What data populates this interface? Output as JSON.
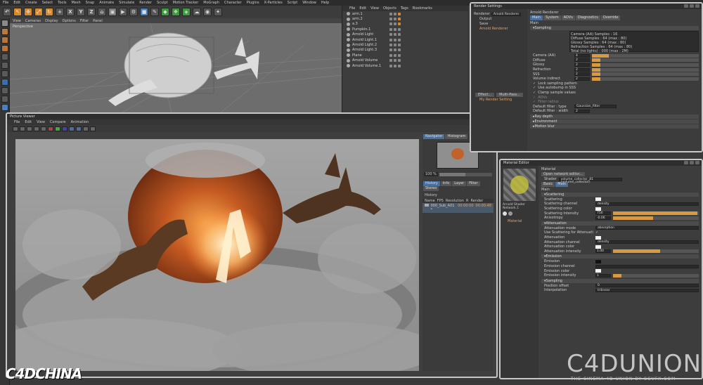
{
  "menubar": [
    "File",
    "Edit",
    "Create",
    "Select",
    "Tools",
    "Mesh",
    "Snap",
    "Animate",
    "Simulate",
    "Render",
    "Sculpt",
    "Motion Tracker",
    "MoGraph",
    "Character",
    "Plugins",
    "X-Particles",
    "Script",
    "Window",
    "Help"
  ],
  "toolbar_letters": [
    "X",
    "Y",
    "Z"
  ],
  "viewport": {
    "menu": [
      "View",
      "Cameras",
      "Display",
      "Options",
      "Filter",
      "Panel"
    ],
    "label": "Perspective"
  },
  "object_manager": {
    "menu": [
      "File",
      "Edit",
      "View",
      "Objects",
      "Tags",
      "Bookmarks"
    ],
    "objects": [
      "arm.1",
      "arm.2",
      "a.3",
      "Pumpkin.1",
      "Arnold Light",
      "Arnold Light.1",
      "Arnold Light.2",
      "Arnold Light.3",
      "Plane",
      "Arnold Volume",
      "Arnold Volume.1"
    ]
  },
  "picture_viewer": {
    "title": "Picture Viewer",
    "menu": [
      "File",
      "Edit",
      "View",
      "Compare",
      "Animation"
    ],
    "nav_tabs": [
      "Navigator",
      "Histogram"
    ],
    "zoom": "100 %",
    "info_tabs": [
      "History",
      "Info",
      "Layer",
      "Filter",
      "Stereo"
    ],
    "history_label": "History",
    "history_headers": [
      "Name",
      "FPS",
      "Resolution",
      "R",
      "Render"
    ],
    "history_row": {
      "name": "000_Sub_A01 *",
      "time": "00:00:00",
      "render": "00:00:48"
    }
  },
  "render_settings": {
    "title": "Render Settings",
    "renderer_label": "Renderer",
    "renderer_value": "Arnold Renderer",
    "left_items": [
      "Output",
      "Save",
      "Arnold Renderer"
    ],
    "effect_btn": "Effect...",
    "multipass_btn": "Multi-Pass...",
    "my_settings": "My Render Setting",
    "header": "Arnold Renderer",
    "tabs": [
      "Main",
      "System",
      "AOVs",
      "Diagnostics",
      "Override"
    ],
    "main_label": "Main",
    "sampling_section": "Sampling",
    "info_lines": [
      "Camera (AA) Samples : 16",
      "Diffuse Samples : 64 (max : 80)",
      "Glossy Samples : 64 (max : 80)",
      "Refraction Samples : 64 (max : 80)",
      "Total (no lights) : 000 (max : 2M)"
    ],
    "params": [
      {
        "label": "Camera (AA)",
        "value": "4"
      },
      {
        "label": "Diffuse",
        "value": "2"
      },
      {
        "label": "Glossy",
        "value": "2"
      },
      {
        "label": "Refraction",
        "value": "2"
      },
      {
        "label": "SSS",
        "value": "2"
      },
      {
        "label": "Volume indirect",
        "value": "2"
      }
    ],
    "options": [
      "Lock sampling pattern",
      "Use autobump in SSS",
      "Clamp sample values",
      "AOVs",
      "Filter radius"
    ],
    "filter_type_label": "Default filter : type",
    "filter_type_value": "Gaussian_filter",
    "filter_width_label": "Default filter : width",
    "filter_width_value": "2",
    "sections": [
      "Ray depth",
      "Environment",
      "Motion blur"
    ]
  },
  "material_editor": {
    "title": "Material Editor",
    "node_label": "Arnold Shader Network.1",
    "material_label": "Material",
    "top_label": "Material",
    "open_btn": "Open network editor...",
    "shader_label": "Shader",
    "shader_value": "volume_collector_81 (volume_collector)",
    "tabs": [
      "Basic",
      "Main"
    ],
    "main_label": "Main",
    "scattering": {
      "title": "Scattering",
      "rows": [
        {
          "label": "Scattering",
          "type": "swatch"
        },
        {
          "label": "Scattering channel",
          "value": "density"
        },
        {
          "label": "Scattering color",
          "type": "swatch"
        },
        {
          "label": "Scattering intensity",
          "value": "750",
          "fill": 0.98
        },
        {
          "label": "Anisotropy",
          "value": "-0.06",
          "fill": 0.47
        }
      ]
    },
    "attenuation": {
      "title": "Attenuation",
      "rows": [
        {
          "label": "Attenuation mode",
          "value": "absorption"
        },
        {
          "label": "Use Scattering for Attenuation",
          "type": "check"
        },
        {
          "label": "Attenuation",
          "type": "swatch"
        },
        {
          "label": "Attenuation channel",
          "value": "density"
        },
        {
          "label": "Attenuation color",
          "type": "swatch"
        },
        {
          "label": "Attenuation intensity",
          "value": "1.00",
          "fill": 0.55
        }
      ]
    },
    "emission": {
      "title": "Emission",
      "rows": [
        {
          "label": "Emission",
          "type": "swatch-k"
        },
        {
          "label": "Emission channel",
          "value": ""
        },
        {
          "label": "Emission color",
          "type": "swatch"
        },
        {
          "label": "Emission intensity",
          "value": "1",
          "fill": 0.1
        }
      ]
    },
    "sampling": {
      "title": "Sampling",
      "rows": [
        {
          "label": "Position offset",
          "value": "0"
        },
        {
          "label": "Interpolation",
          "value": "trilinear"
        }
      ]
    }
  },
  "watermarks": {
    "left": "C4DCHINA",
    "right": "C4DUNION",
    "right_sub": "THE CINEMA 4D UNION  BY CGVFX.COM"
  },
  "colors": {
    "accent": "#4a6f9c",
    "orange": "#d89a40",
    "selected": "#e8a060"
  }
}
